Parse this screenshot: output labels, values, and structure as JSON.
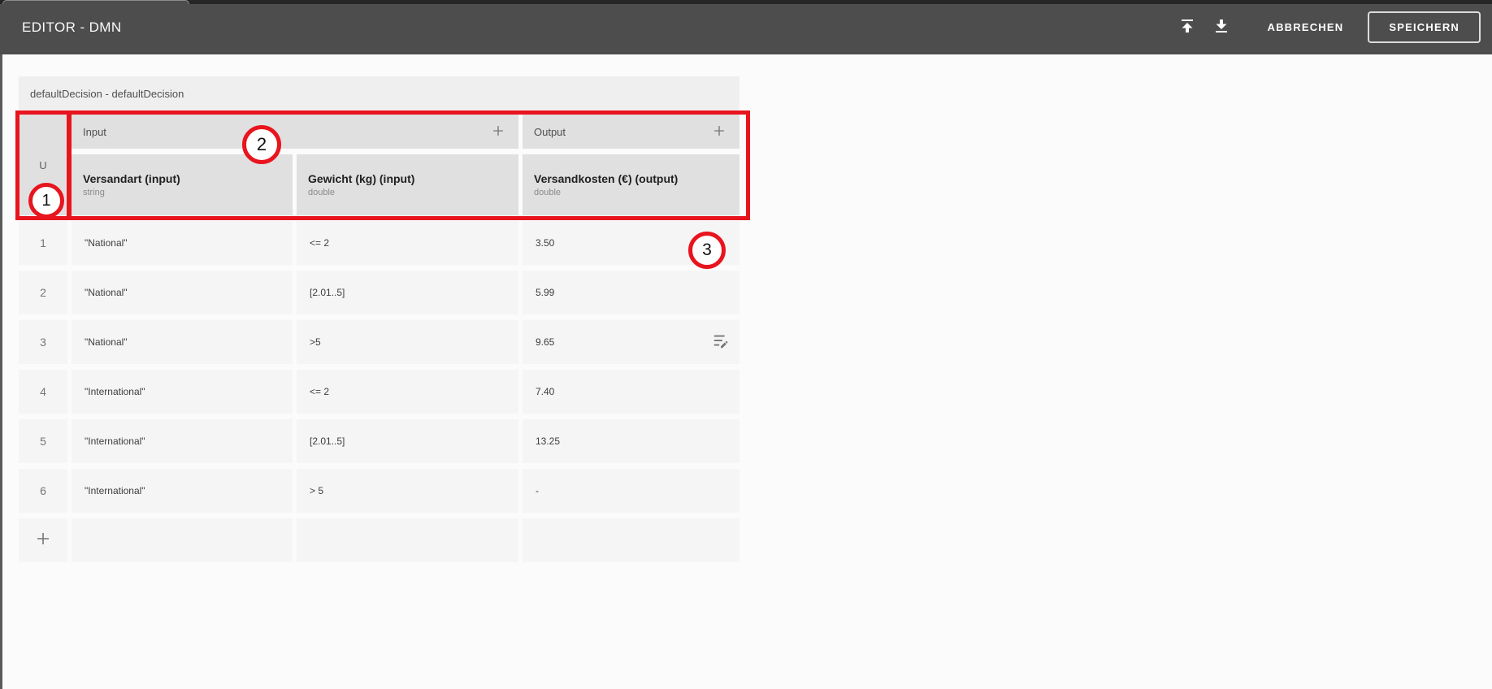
{
  "topbar": {
    "title": "EDITOR - DMN",
    "cancel_label": "ABBRECHEN",
    "save_label": "SPEICHERN"
  },
  "table": {
    "title": "defaultDecision - defaultDecision",
    "hit_policy": "U",
    "input_group_label": "Input",
    "output_group_label": "Output",
    "columns": [
      {
        "name": "Versandart (input)",
        "type": "string"
      },
      {
        "name": "Gewicht (kg) (input)",
        "type": "double"
      },
      {
        "name": "Versandkosten (€) (output)",
        "type": "double"
      }
    ],
    "rows": [
      {
        "num": "1",
        "cells": [
          "\"National\"",
          "<= 2",
          "3.50"
        ]
      },
      {
        "num": "2",
        "cells": [
          "\"National\"",
          "[2.01..5]",
          "5.99"
        ]
      },
      {
        "num": "3",
        "cells": [
          "\"National\"",
          ">5",
          "9.65"
        ]
      },
      {
        "num": "4",
        "cells": [
          "\"International\"",
          "<= 2",
          "7.40"
        ]
      },
      {
        "num": "5",
        "cells": [
          "\"International\"",
          "[2.01..5]",
          "13.25"
        ]
      },
      {
        "num": "6",
        "cells": [
          "\"International\"",
          "> 5",
          "-"
        ]
      }
    ],
    "add_row_label": "+"
  },
  "annotations": {
    "color": "#e8141e",
    "items": [
      {
        "label": "1"
      },
      {
        "label": "2"
      },
      {
        "label": "3"
      }
    ]
  }
}
